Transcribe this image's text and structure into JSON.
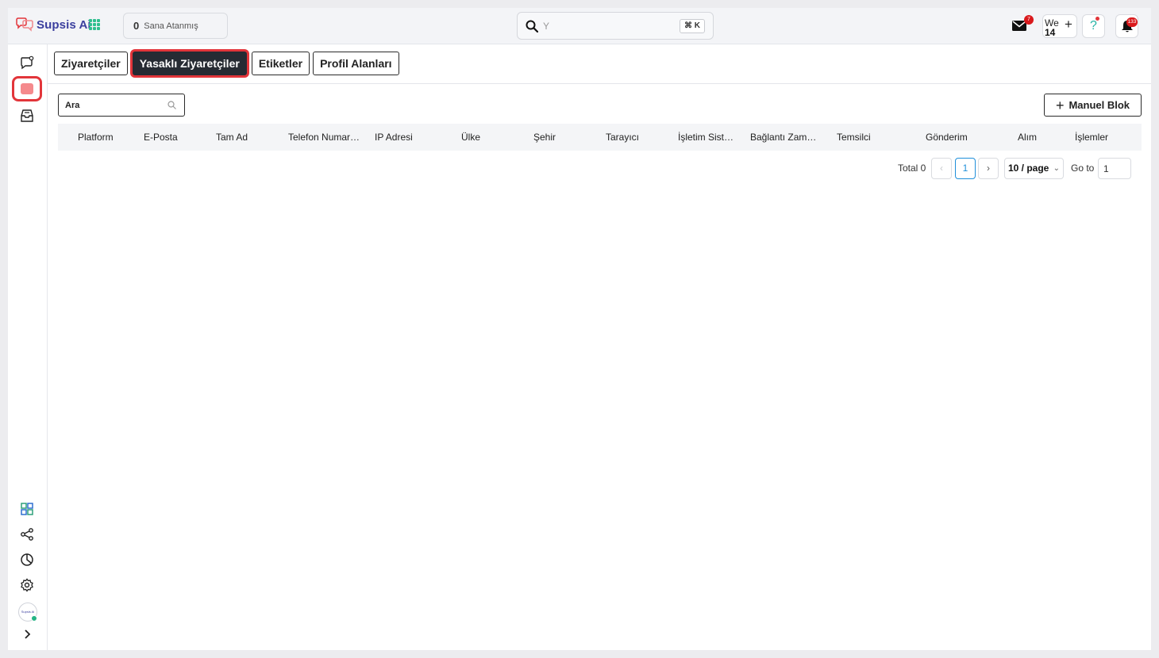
{
  "app": {
    "name": "Supsis Ai"
  },
  "header": {
    "assigned_count": "0",
    "assigned_label": "Sana Atanmış",
    "search_placeholder": "Y",
    "search_shortcut": "⌘ K",
    "mail_badge": "7",
    "workspace_label": "We",
    "workspace_number": "14",
    "help_label": "?",
    "notifications_badge": "133"
  },
  "tabs": [
    {
      "label": "Ziyaretçiler",
      "active": false
    },
    {
      "label": "Yasaklı Ziyaretçiler",
      "active": true
    },
    {
      "label": "Etiketler",
      "active": false
    },
    {
      "label": "Profil Alanları",
      "active": false
    }
  ],
  "toolbar": {
    "search_placeholder": "Ara",
    "manual_block_label": "Manuel Blok"
  },
  "table": {
    "columns": [
      "Platform",
      "E-Posta",
      "Tam Ad",
      "Telefon Numarası",
      "IP Adresi",
      "Ülke",
      "Şehir",
      "Tarayıcı",
      "İşletim Sistemi",
      "Bağlantı Zamanı",
      "Temsilci",
      "Gönderim",
      "Alım",
      "İşlemler"
    ],
    "rows": []
  },
  "pagination": {
    "total_label": "Total 0",
    "current_page": "1",
    "page_size": "10 / page",
    "goto_label": "Go to",
    "goto_value": "1"
  },
  "sidebar": {
    "avatar_label": "Supsis Ai"
  },
  "colors": {
    "accent_red": "#e2353a",
    "brand": "#3b3f9e",
    "active_tab_bg": "#262b33",
    "pagination_blue": "#1f8fda"
  }
}
